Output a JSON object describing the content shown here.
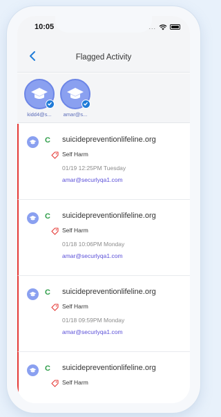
{
  "status_bar": {
    "time": "10:05",
    "dots": "...."
  },
  "nav": {
    "title": "Flagged Activity",
    "back_icon": "chevron-left-icon"
  },
  "avatars": [
    {
      "label": "kidd4@s...",
      "icon": "graduation-cap-icon"
    },
    {
      "label": "amar@s...",
      "icon": "graduation-cap-icon"
    }
  ],
  "activities": [
    {
      "browser_icon": "C",
      "domain": "suicidepreventionlifeline.org",
      "category": "Self Harm",
      "timestamp": "01/19 12:25PM Tuesday",
      "email": "amar@securlyqa1.com"
    },
    {
      "browser_icon": "C",
      "domain": "suicidepreventionlifeline.org",
      "category": "Self Harm",
      "timestamp": "01/18 10:06PM Monday",
      "email": "amar@securlyqa1.com"
    },
    {
      "browser_icon": "C",
      "domain": "suicidepreventionlifeline.org",
      "category": "Self Harm",
      "timestamp": "01/18 09:59PM Monday",
      "email": "amar@securlyqa1.com"
    },
    {
      "browser_icon": "C",
      "domain": "suicidepreventionlifeline.org",
      "category": "Self Harm",
      "timestamp": "",
      "email": ""
    }
  ],
  "colors": {
    "accent": "#1f7bd8",
    "flag": "#e53935",
    "avatar": "#8aa0f0",
    "email": "#5a4fd8",
    "browser": "#2e9d49"
  }
}
